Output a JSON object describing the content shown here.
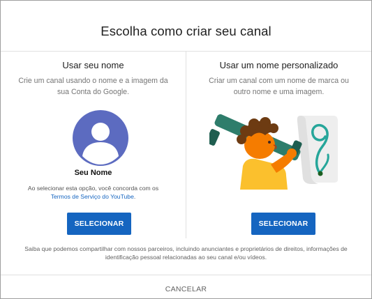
{
  "dialog": {
    "title": "Escolha como criar seu canal"
  },
  "left": {
    "heading": "Usar seu nome",
    "description": "Crie um canal usando o nome e a imagem da sua Conta do Google.",
    "name": "Seu Nome",
    "consent_prefix": "Ao selecionar esta opção, você concorda com os",
    "terms_link": "Termos de Serviço do YouTube",
    "consent_suffix": ".",
    "button_label": "SELECIONAR"
  },
  "right": {
    "heading": "Usar um nome personalizado",
    "description": "Criar um canal com um nome de marca ou outro nome e uma imagem.",
    "button_label": "SELECIONAR"
  },
  "footer": {
    "disclaimer": "Saiba que podemos compartilhar com nossos parceiros, incluindo anunciantes e proprietários de direitos, informações de identificação pessoal relacionadas ao seu canal e/ou vídeos.",
    "cancel_label": "CANCELAR"
  },
  "colors": {
    "accent": "#1565c0",
    "avatar": "#5c6bc0"
  }
}
